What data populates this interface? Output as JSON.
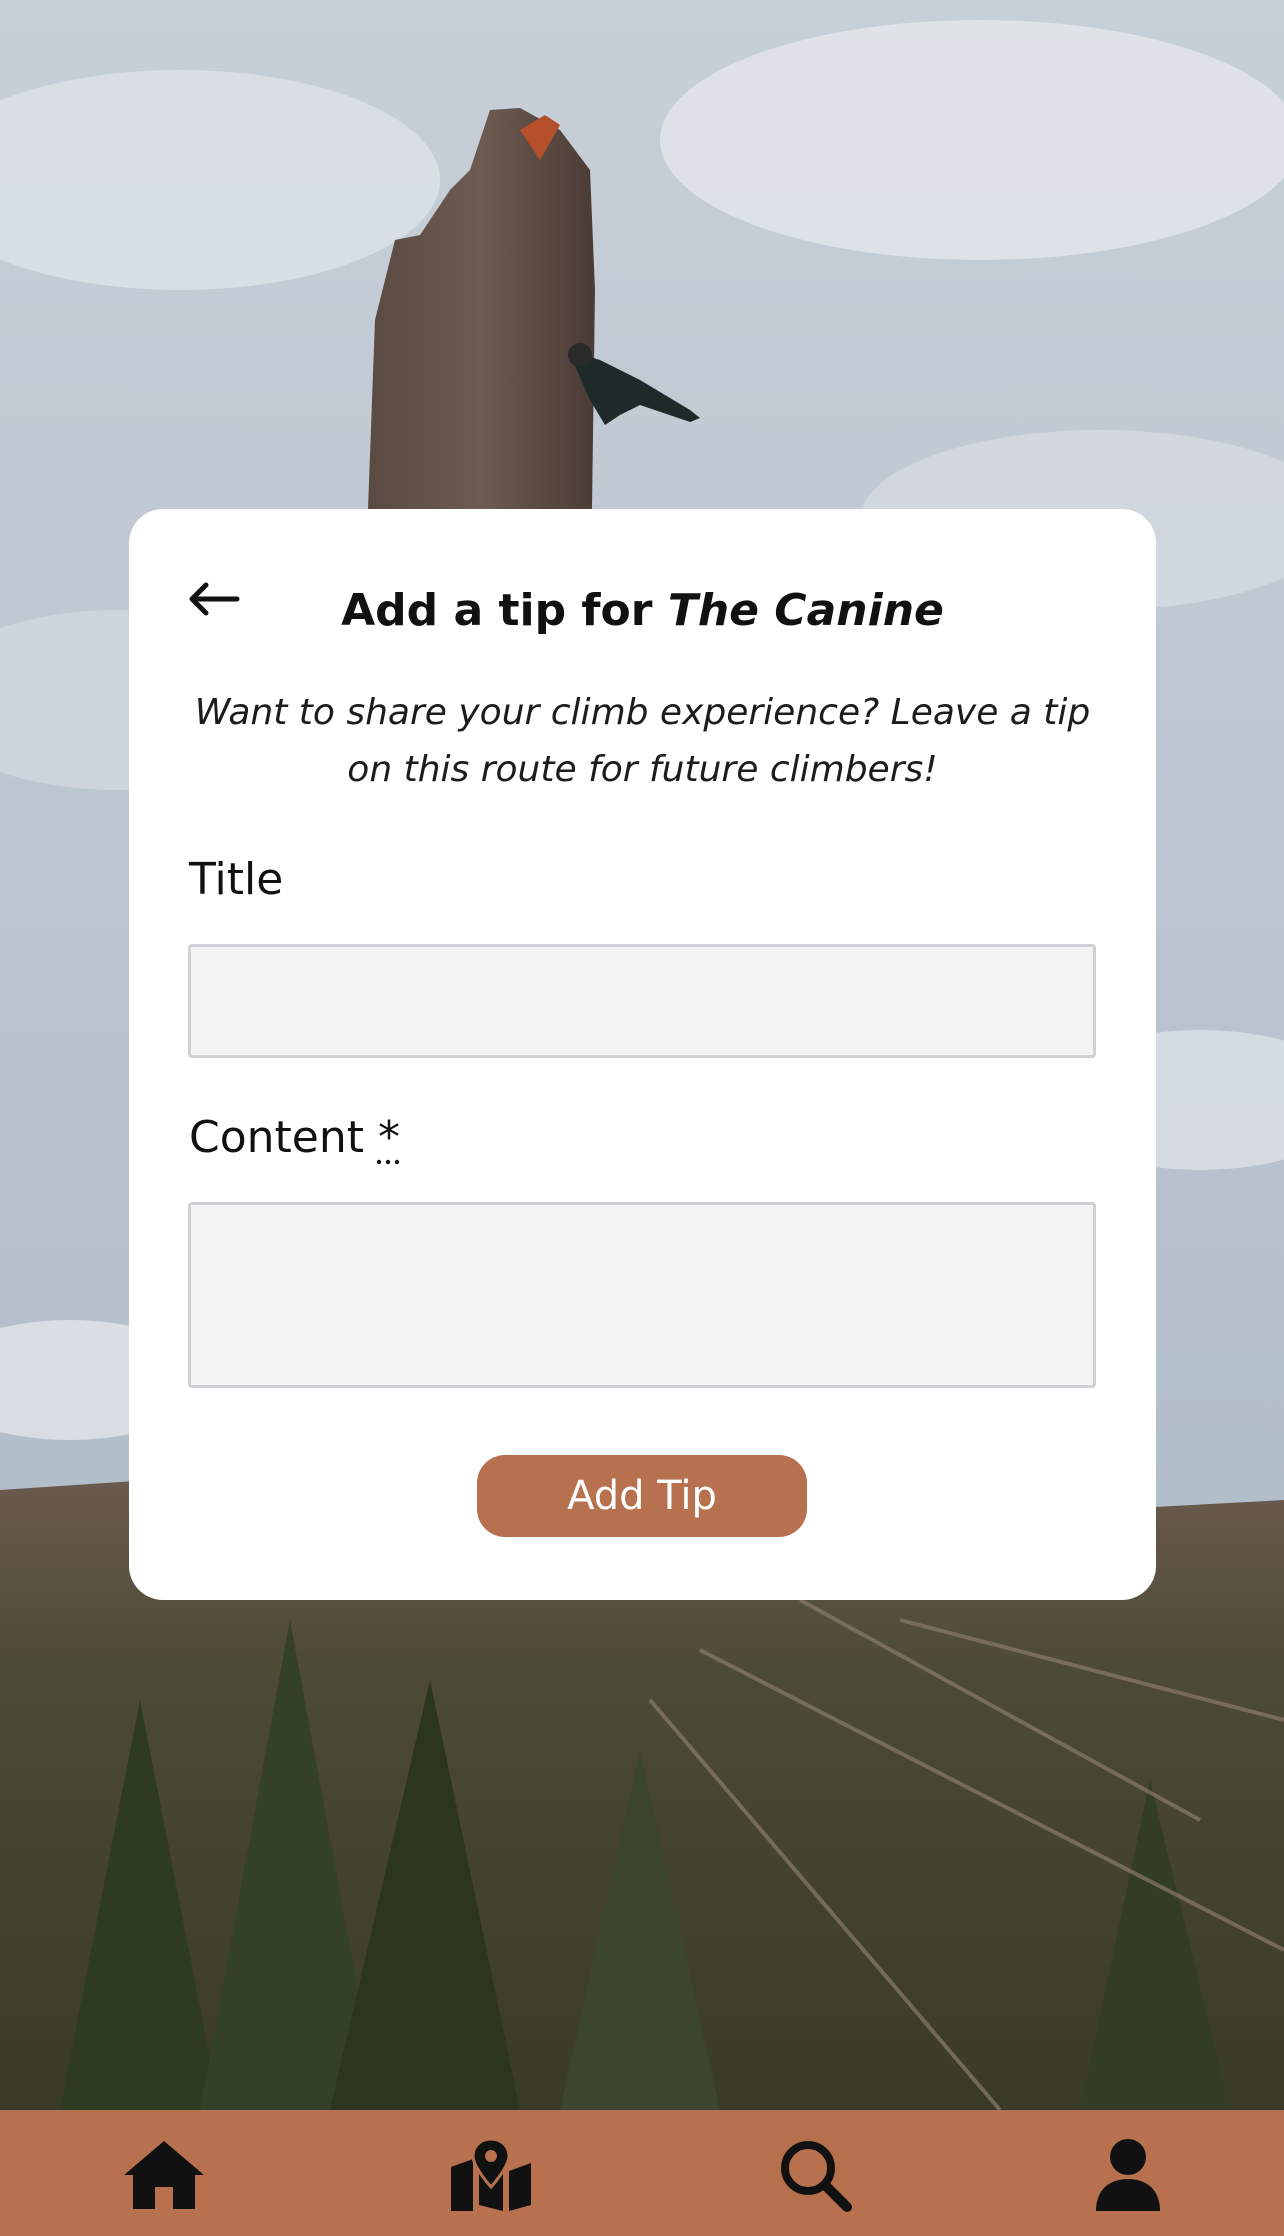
{
  "header": {
    "title_prefix": "Add a tip for ",
    "route_name": "The Canine"
  },
  "intro": {
    "text": "Want to share your climb experience? Leave a tip on this route for future climbers!"
  },
  "form": {
    "title_label": "Title",
    "title_value": "",
    "content_label": "Content ",
    "content_required_marker": "*",
    "content_value": "",
    "submit_label": "Add Tip"
  },
  "icons": {
    "back": "arrow-left-icon",
    "home": "home-icon",
    "map": "map-pin-icon",
    "search": "search-icon",
    "profile": "user-icon"
  },
  "colors": {
    "accent": "#b8714f",
    "card": "#ffffff",
    "input_bg": "#f3f3f3",
    "input_border": "#cfd1d4",
    "text": "#111111"
  }
}
